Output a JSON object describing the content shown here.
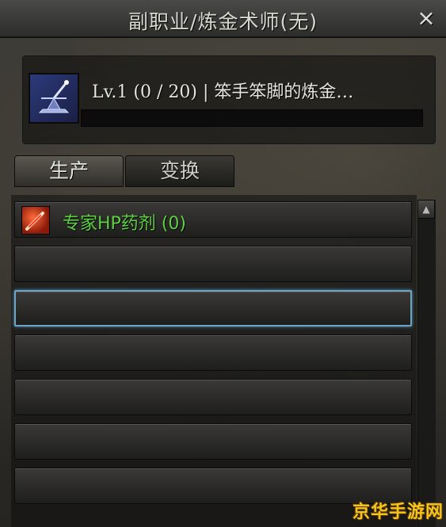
{
  "window": {
    "title": "副职业/炼金术师(无)",
    "close_glyph": "×"
  },
  "skill": {
    "icon": "alchemy-flask-icon",
    "level_text": "Lv.1 (0 / 20) | 笨手笨脚的炼金…",
    "exp_current": 0,
    "exp_max": 20
  },
  "tabs": [
    {
      "label": "生产",
      "active": true
    },
    {
      "label": "变换",
      "active": false
    }
  ],
  "recipes": [
    {
      "name": "专家HP药剂 (0)",
      "icon": "hp-potion-icon",
      "color": "#5cd041"
    }
  ],
  "empty_rows": 6,
  "selected_row": 2,
  "watermark": "京华手游网",
  "colors": {
    "recipe_green": "#5cd041",
    "selection_border": "#6fa3c2",
    "watermark_gold": "#f5c420"
  }
}
